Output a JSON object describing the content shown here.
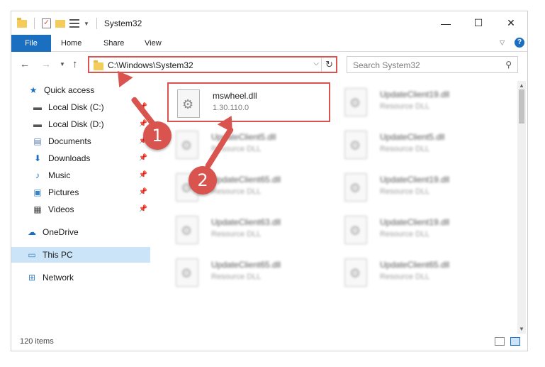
{
  "window": {
    "title": "System32",
    "controls": {
      "minimize": "—",
      "maximize": "☐",
      "close": "✕"
    }
  },
  "ribbon": {
    "tabs": [
      "File",
      "Home",
      "Share",
      "View"
    ],
    "help": "?"
  },
  "address_bar": {
    "path": "C:\\Windows\\System32",
    "search_placeholder": "Search System32"
  },
  "sidebar": {
    "items": [
      {
        "label": "Quick access",
        "icon": "star-icon",
        "pinned": false
      },
      {
        "label": "Local Disk (C:)",
        "icon": "drive-icon",
        "pinned": true
      },
      {
        "label": "Local Disk (D:)",
        "icon": "drive-icon",
        "pinned": true
      },
      {
        "label": "Documents",
        "icon": "documents-icon",
        "pinned": true
      },
      {
        "label": "Downloads",
        "icon": "downloads-icon",
        "pinned": true
      },
      {
        "label": "Music",
        "icon": "music-icon",
        "pinned": true
      },
      {
        "label": "Pictures",
        "icon": "pictures-icon",
        "pinned": true
      },
      {
        "label": "Videos",
        "icon": "videos-icon",
        "pinned": true
      },
      {
        "label": "OneDrive",
        "icon": "cloud-icon",
        "pinned": false
      },
      {
        "label": "This PC",
        "icon": "computer-icon",
        "pinned": false,
        "selected": true
      },
      {
        "label": "Network",
        "icon": "network-icon",
        "pinned": false
      }
    ]
  },
  "files": [
    {
      "name": "mswheel.dll",
      "sub": "1.30.110.0",
      "highlight": true
    },
    {
      "name": "UpdateClient19.dll",
      "sub": "Resource DLL"
    },
    {
      "name": "UpdateClient5.dll",
      "sub": "Resource DLL"
    },
    {
      "name": "UpdateClient5.dll",
      "sub": "Resource DLL"
    },
    {
      "name": "UpdateClient65.dll",
      "sub": "Resource DLL"
    },
    {
      "name": "UpdateClient19.dll",
      "sub": "Resource DLL"
    },
    {
      "name": "UpdateClient63.dll",
      "sub": "Resource DLL"
    },
    {
      "name": "UpdateClient19.dll",
      "sub": "Resource DLL"
    },
    {
      "name": "UpdateClient65.dll",
      "sub": "Resource DLL"
    },
    {
      "name": "UpdateClient65.dll",
      "sub": "Resource DLL"
    }
  ],
  "status": {
    "count": "120 items"
  },
  "annotations": {
    "step1": "1",
    "step2": "2"
  },
  "colors": {
    "accent": "#1a6fc1",
    "annotation": "#d9534f",
    "selection": "#cce4f7"
  }
}
